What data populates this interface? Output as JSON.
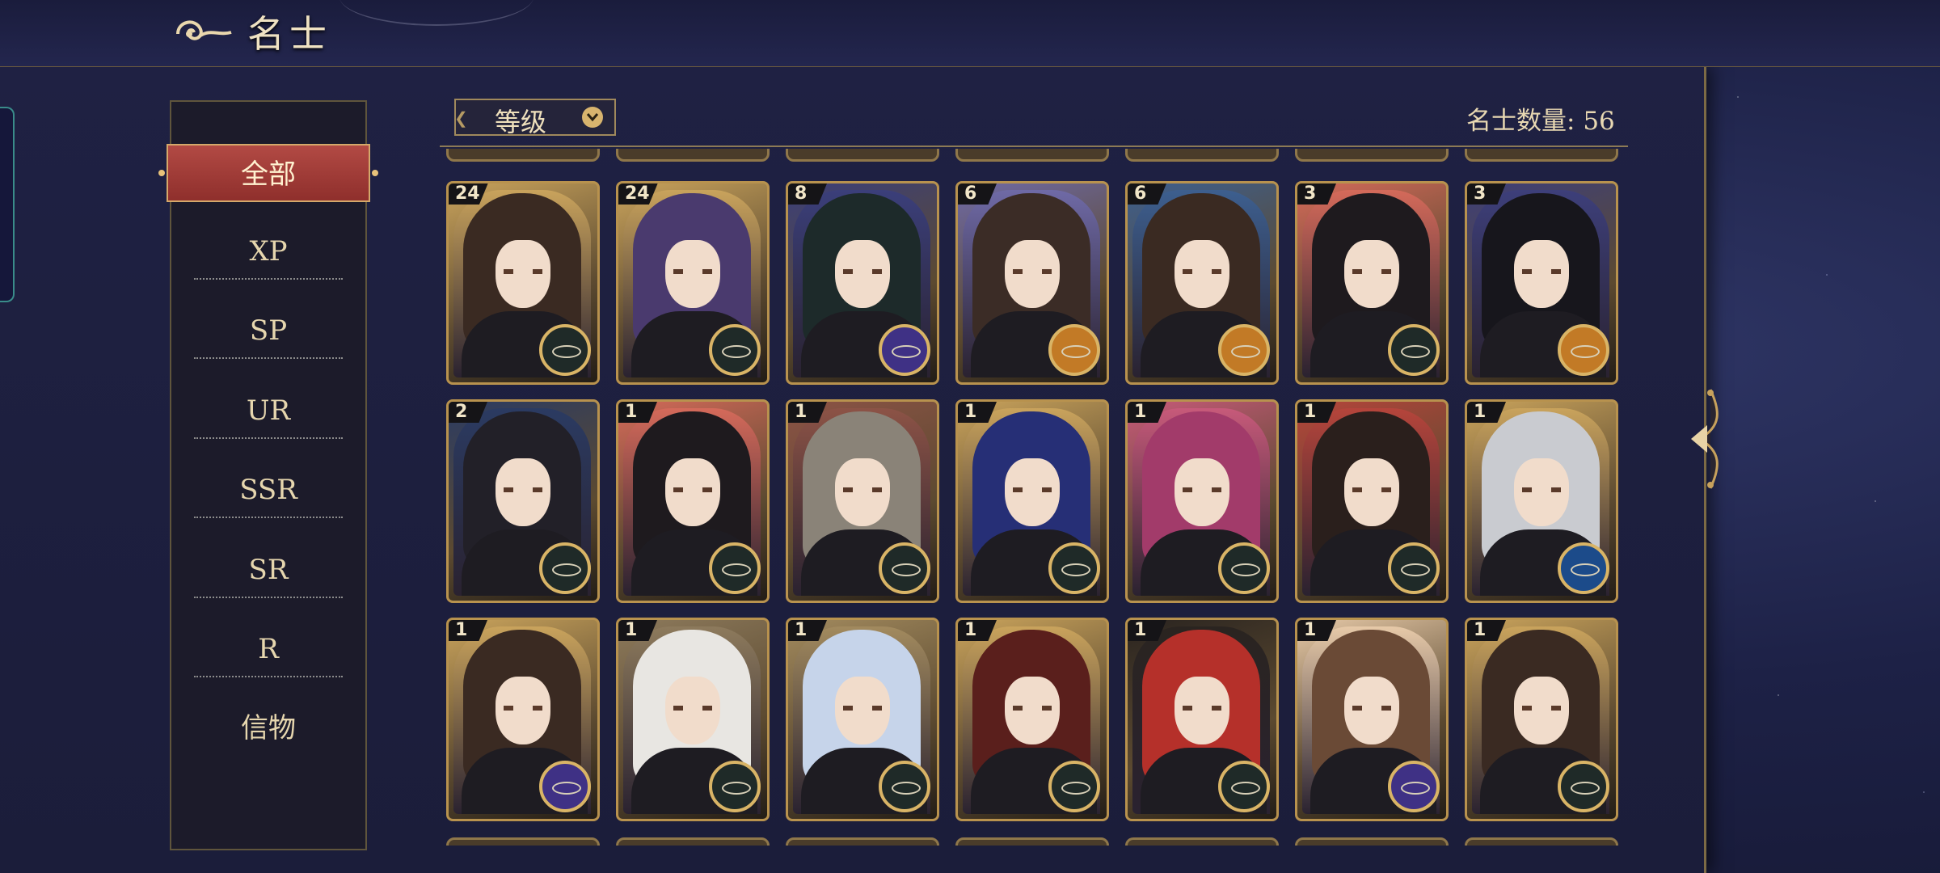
{
  "header": {
    "title": "名士"
  },
  "filters": {
    "items": [
      {
        "label": "全部",
        "active": true
      },
      {
        "label": "XP"
      },
      {
        "label": "SP"
      },
      {
        "label": "UR"
      },
      {
        "label": "SSR"
      },
      {
        "label": "SR"
      },
      {
        "label": "R"
      },
      {
        "label": "信物"
      }
    ]
  },
  "sort": {
    "label": "等级",
    "icon": "chevron-down-icon"
  },
  "count": {
    "label": "名士数量:",
    "value": "56"
  },
  "colors": {
    "accent_gold": "#b8924e",
    "active_red": "#9f3733",
    "panel": "#1c1b2a"
  },
  "cards": [
    {
      "level": "24",
      "emblem": "dark",
      "palette": "dark-brown"
    },
    {
      "level": "24",
      "emblem": "dark",
      "palette": "purple"
    },
    {
      "level": "8",
      "emblem": "purple",
      "palette": "green-black"
    },
    {
      "level": "6",
      "emblem": "orange",
      "palette": "brown-lavender"
    },
    {
      "level": "6",
      "emblem": "orange",
      "palette": "brown-blue"
    },
    {
      "level": "3",
      "emblem": "dark",
      "palette": "black-red"
    },
    {
      "level": "3",
      "emblem": "orange",
      "palette": "black-indigo"
    },
    {
      "level": "2",
      "emblem": "dark",
      "palette": "black-blue"
    },
    {
      "level": "1",
      "emblem": "dark",
      "palette": "black-red"
    },
    {
      "level": "1",
      "emblem": "dark",
      "palette": "grey"
    },
    {
      "level": "1",
      "emblem": "dark",
      "palette": "navy"
    },
    {
      "level": "1",
      "emblem": "dark",
      "palette": "magenta"
    },
    {
      "level": "1",
      "emblem": "dark",
      "palette": "black-crimson"
    },
    {
      "level": "1",
      "emblem": "blue",
      "palette": "silver"
    },
    {
      "level": "1",
      "emblem": "purple",
      "palette": "dark-brown"
    },
    {
      "level": "1",
      "emblem": "dark",
      "palette": "white"
    },
    {
      "level": "1",
      "emblem": "dark",
      "palette": "pale-blue"
    },
    {
      "level": "1",
      "emblem": "dark",
      "palette": "dark-red"
    },
    {
      "level": "1",
      "emblem": "dark",
      "palette": "red"
    },
    {
      "level": "1",
      "emblem": "purple",
      "palette": "light-brown"
    },
    {
      "level": "1",
      "emblem": "dark",
      "palette": "dark-brown"
    }
  ]
}
